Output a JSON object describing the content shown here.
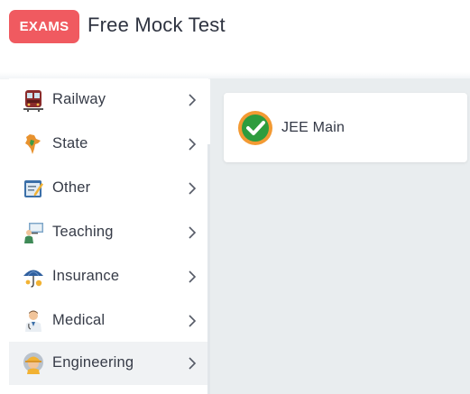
{
  "header": {
    "badge": "EXAMS",
    "title": "Free Mock Test"
  },
  "sidebar": {
    "items": [
      {
        "label": "Railway",
        "icon": "train-icon"
      },
      {
        "label": "State",
        "icon": "india-map-icon"
      },
      {
        "label": "Other",
        "icon": "clipboard-pen-icon"
      },
      {
        "label": "Teaching",
        "icon": "teacher-board-icon"
      },
      {
        "label": "Insurance",
        "icon": "umbrella-icon"
      },
      {
        "label": "Medical",
        "icon": "doctor-icon"
      },
      {
        "label": "Engineering",
        "icon": "engineer-helmet-icon"
      }
    ],
    "active": "Engineering"
  },
  "main": {
    "exams": [
      {
        "label": "JEE Main",
        "icon": "check-badge-icon"
      }
    ]
  },
  "colors": {
    "badge": "#f05a60",
    "content_bg": "#e9edef",
    "active_item_bg": "#f0f2f4",
    "check_green": "#2e9c3e",
    "check_ring": "#f39a33"
  }
}
